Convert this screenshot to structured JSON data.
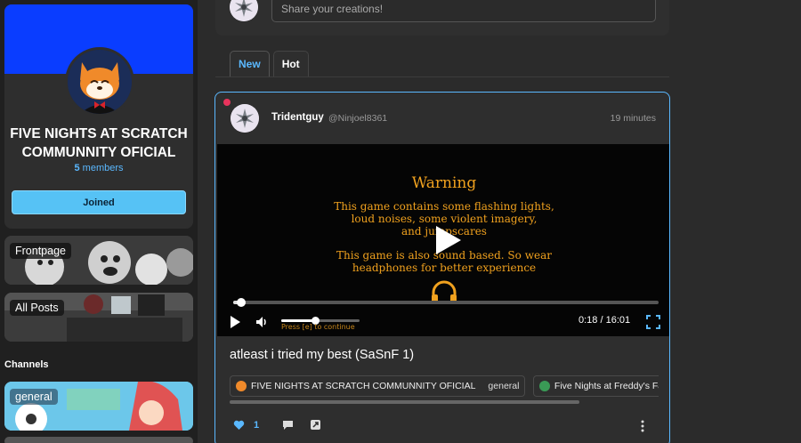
{
  "community": {
    "title": "FIVE NIGHTS AT SCRATCH COMMUNNITY OFICIAL",
    "members_count": "5",
    "members_label": " members",
    "join_label": "Joined"
  },
  "nav": {
    "frontpage": "Frontpage",
    "all_posts": "All Posts",
    "channels_heading": "Channels",
    "channel_general": "general"
  },
  "composer": {
    "placeholder": "Share your creations!"
  },
  "tabs": [
    {
      "label": "New",
      "active": true
    },
    {
      "label": "Hot",
      "active": false
    }
  ],
  "post": {
    "author": "Tridentguy",
    "handle": "@Ninjoel8361",
    "time_ago": "19 minutes",
    "title": "atleast i tried my best (SaSnF 1)",
    "video": {
      "warning_title": "Warning",
      "warning_line1": "This game contains some flashing lights,",
      "warning_line2": "loud noises, some violent imagery,",
      "warning_line3": "and jumpscares",
      "warning_line4": "This game is also sound based. So wear",
      "warning_line5": "headphones for better experience",
      "hint": "Press [e] to continue",
      "current_time": "0:18",
      "separator": " / ",
      "duration": "16:01",
      "progress_fraction": 0.019,
      "volume_fraction": 0.43
    },
    "chips": [
      {
        "label": "FIVE NIGHTS AT SCRATCH COMMUNNITY OFICIAL",
        "sub": "general"
      },
      {
        "label": "Five Nights at Freddy's Fan C"
      }
    ],
    "likes": "1"
  },
  "colors": {
    "accent": "#5ab8ff",
    "join_button": "#56c2f5",
    "banner": "#0a3dff",
    "warning_text": "#f0a11e",
    "unread": "#e8335c"
  },
  "icons": [
    "cat-mascot-avatar",
    "play-icon",
    "volume-icon",
    "fullscreen-icon",
    "headphones-icon",
    "heart-icon",
    "comment-icon",
    "share-icon",
    "more-vertical-icon"
  ]
}
